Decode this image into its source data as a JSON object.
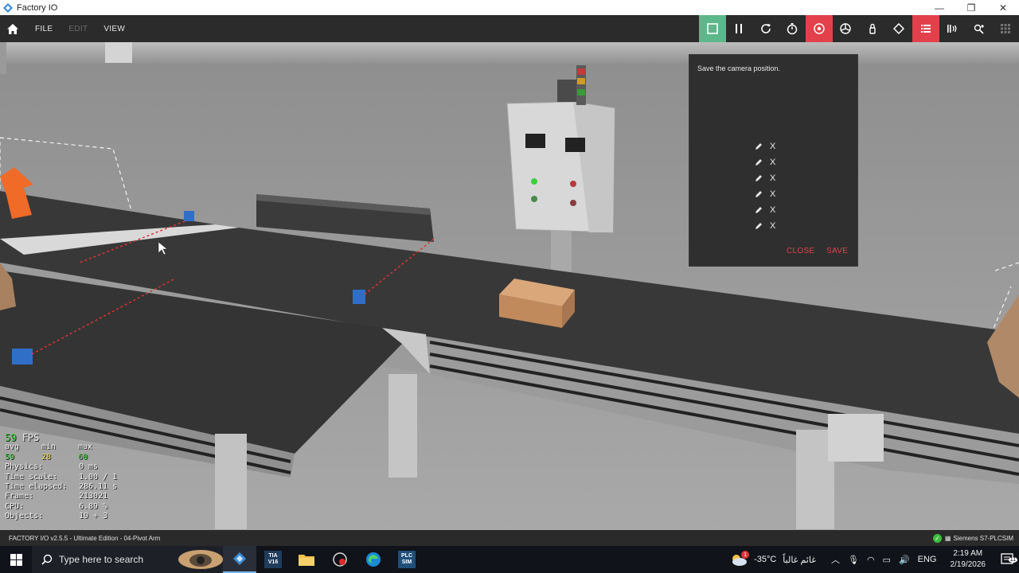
{
  "window": {
    "title": "Factory IO",
    "controls": [
      "—",
      "❐",
      "✕"
    ]
  },
  "menu": {
    "items": [
      {
        "label": "FILE",
        "enabled": true
      },
      {
        "label": "EDIT",
        "enabled": false
      },
      {
        "label": "VIEW",
        "enabled": true
      }
    ]
  },
  "toolbar": {
    "icons": [
      "stop-icon",
      "pause-icon",
      "reset-icon",
      "timer-icon",
      "camera-position-icon",
      "fly-camera-icon",
      "lock-icon",
      "selection-icon",
      "list-icon",
      "sensor-icon",
      "drivers-icon",
      "grid-icon"
    ],
    "active_green": "stop-icon",
    "active_red": [
      "camera-position-icon",
      "list-icon"
    ],
    "colors": {
      "green": "#5cb88a",
      "red": "#e2414c"
    }
  },
  "camera_panel": {
    "title": "Save the camera position.",
    "rows": [
      {
        "x_label": "X"
      },
      {
        "x_label": "X"
      },
      {
        "x_label": "X"
      },
      {
        "x_label": "X"
      },
      {
        "x_label": "X"
      },
      {
        "x_label": "X"
      }
    ],
    "close_label": "CLOSE",
    "save_label": "SAVE"
  },
  "stats": {
    "fps_value": "59",
    "fps_label": "FPS",
    "hdr_avg": "avg",
    "hdr_min": "min",
    "hdr_max": "max",
    "avg": "59",
    "min": "28",
    "max": "60",
    "rows": [
      {
        "key": "Physics:",
        "value": "0 ms"
      },
      {
        "key": "Time scale:",
        "value": "1.00 / 1"
      },
      {
        "key": "Time elapsed:",
        "value": "286.11 s"
      },
      {
        "key": "Frame:",
        "value": "213021"
      },
      {
        "key": "CPU:",
        "value": "6.89 %"
      },
      {
        "key": "Objects:",
        "value": "19 + 3"
      }
    ]
  },
  "statusbar": {
    "left": "FACTORY I/O v2.5.5 - Ultimate Edition - 04-Pivot Arm",
    "right": "Siemens S7-PLCSIM"
  },
  "taskbar": {
    "search_placeholder": "Type here to search",
    "apps": [
      "factory-io-app",
      "tia-portal-app",
      "file-explorer-app",
      "record-app",
      "edge-app",
      "plcsim-app"
    ],
    "tia_label": "TIA V16",
    "plcsim_label": "PLC SIM",
    "weather_temp": "-35°C",
    "weather_text": "غائم غالباً",
    "weather_badge": "1",
    "lang": "ENG",
    "time": "2:19 AM",
    "date": "2/19/2026",
    "notification_count": "11"
  }
}
